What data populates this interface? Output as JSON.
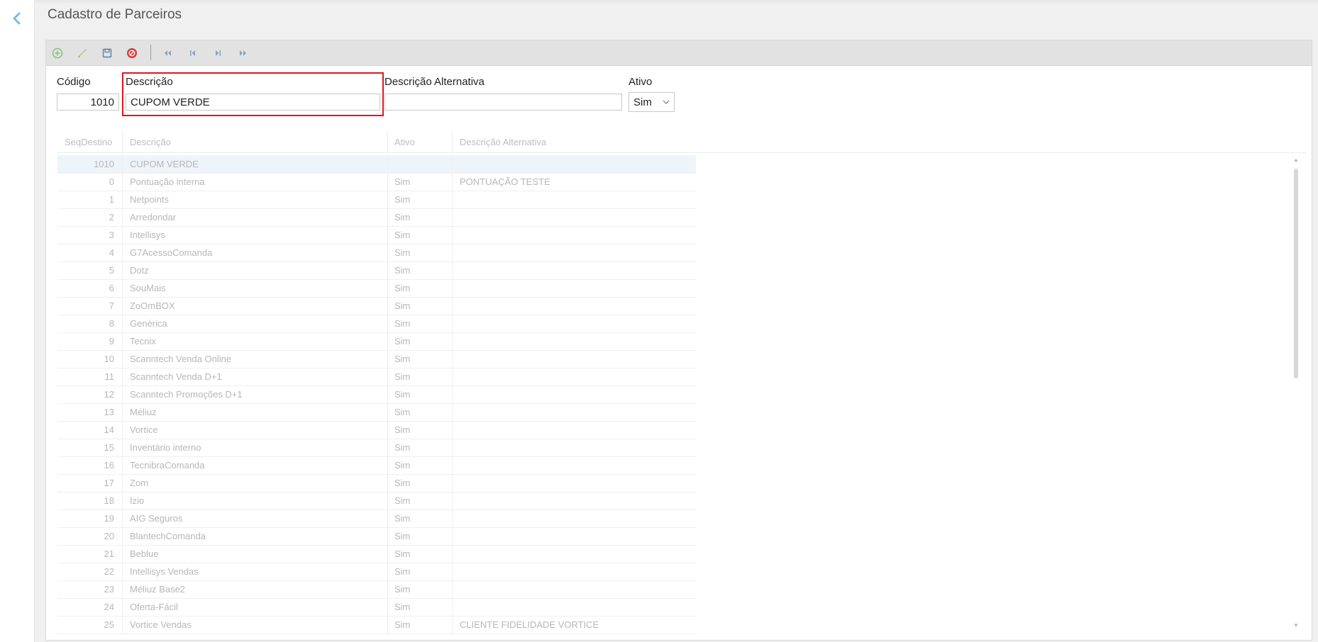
{
  "page": {
    "title": "Cadastro de Parceiros",
    "back_icon": "chevron-left-icon"
  },
  "toolbar": {
    "buttons": [
      {
        "name": "add-button",
        "icon": "plus-circle-icon",
        "color": "#7cc67c"
      },
      {
        "name": "edit-button",
        "icon": "pencil-icon",
        "color": "#b6c77a"
      },
      {
        "name": "save-button",
        "icon": "floppy-icon",
        "color": "#5f7fa3"
      },
      {
        "name": "cancel-button",
        "icon": "cancel-circle-icon",
        "color": "#d93a3a"
      },
      {
        "name": "first-button",
        "icon": "first-icon",
        "color": "#8aa2c4"
      },
      {
        "name": "previous-button",
        "icon": "previous-icon",
        "color": "#8aa2c4"
      },
      {
        "name": "next-button",
        "icon": "next-icon",
        "color": "#8aa2c4"
      },
      {
        "name": "last-button",
        "icon": "last-icon",
        "color": "#8aa2c4"
      }
    ]
  },
  "form": {
    "codigo_label": "Código",
    "codigo_value": "1010",
    "descricao_label": "Descrição",
    "descricao_value": "CUPOM VERDE",
    "descricao_alt_label": "Descrição Alternativa",
    "descricao_alt_value": "",
    "ativo_label": "Ativo",
    "ativo_value": "Sim"
  },
  "grid": {
    "columns": [
      "SeqDestino",
      "Descrição",
      "Ativo",
      "Descrição Alternativa"
    ],
    "rows": [
      {
        "seq": "1010",
        "desc": "CUPOM VERDE",
        "ativo": "",
        "alt": ""
      },
      {
        "seq": "0",
        "desc": "Pontuação interna",
        "ativo": "Sim",
        "alt": "PONTUAÇÃO TESTE"
      },
      {
        "seq": "1",
        "desc": "Netpoints",
        "ativo": "Sim",
        "alt": ""
      },
      {
        "seq": "2",
        "desc": "Arredondar",
        "ativo": "Sim",
        "alt": ""
      },
      {
        "seq": "3",
        "desc": "Intellisys",
        "ativo": "Sim",
        "alt": ""
      },
      {
        "seq": "4",
        "desc": "G7AcessoComanda",
        "ativo": "Sim",
        "alt": ""
      },
      {
        "seq": "5",
        "desc": "Dotz",
        "ativo": "Sim",
        "alt": ""
      },
      {
        "seq": "6",
        "desc": "SouMais",
        "ativo": "Sim",
        "alt": ""
      },
      {
        "seq": "7",
        "desc": "ZoOmBOX",
        "ativo": "Sim",
        "alt": ""
      },
      {
        "seq": "8",
        "desc": "Genérica",
        "ativo": "Sim",
        "alt": ""
      },
      {
        "seq": "9",
        "desc": "Tecnix",
        "ativo": "Sim",
        "alt": ""
      },
      {
        "seq": "10",
        "desc": "Scanntech Venda Online",
        "ativo": "Sim",
        "alt": ""
      },
      {
        "seq": "11",
        "desc": "Scanntech Venda D+1",
        "ativo": "Sim",
        "alt": ""
      },
      {
        "seq": "12",
        "desc": "Scanntech Promoções D+1",
        "ativo": "Sim",
        "alt": ""
      },
      {
        "seq": "13",
        "desc": "Méliuz",
        "ativo": "Sim",
        "alt": ""
      },
      {
        "seq": "14",
        "desc": "Vortice",
        "ativo": "Sim",
        "alt": ""
      },
      {
        "seq": "15",
        "desc": "Inventário interno",
        "ativo": "Sim",
        "alt": ""
      },
      {
        "seq": "16",
        "desc": "TecnibraComanda",
        "ativo": "Sim",
        "alt": ""
      },
      {
        "seq": "17",
        "desc": "Zom",
        "ativo": "Sim",
        "alt": ""
      },
      {
        "seq": "18",
        "desc": "Izio",
        "ativo": "Sim",
        "alt": ""
      },
      {
        "seq": "19",
        "desc": "AIG Seguros",
        "ativo": "Sim",
        "alt": ""
      },
      {
        "seq": "20",
        "desc": "BlantechComanda",
        "ativo": "Sim",
        "alt": ""
      },
      {
        "seq": "21",
        "desc": "Beblue",
        "ativo": "Sim",
        "alt": ""
      },
      {
        "seq": "22",
        "desc": "Intellisys Vendas",
        "ativo": "Sim",
        "alt": ""
      },
      {
        "seq": "23",
        "desc": "Méliuz Base2",
        "ativo": "Sim",
        "alt": ""
      },
      {
        "seq": "24",
        "desc": "Oferta-Fácil",
        "ativo": "Sim",
        "alt": ""
      },
      {
        "seq": "25",
        "desc": "Vortice Vendas",
        "ativo": "Sim",
        "alt": "CLIENTE FIDELIDADE VORTICE"
      }
    ]
  }
}
